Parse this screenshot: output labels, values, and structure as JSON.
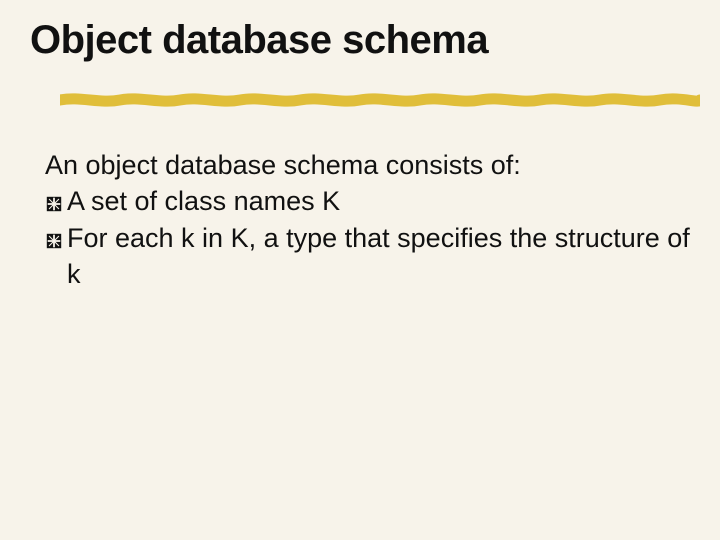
{
  "slide": {
    "title": "Object database schema",
    "intro": "An object database schema consists of:",
    "bullets": [
      "A set of class names K",
      "For each k in K, a type that specifies the structure of k"
    ]
  }
}
